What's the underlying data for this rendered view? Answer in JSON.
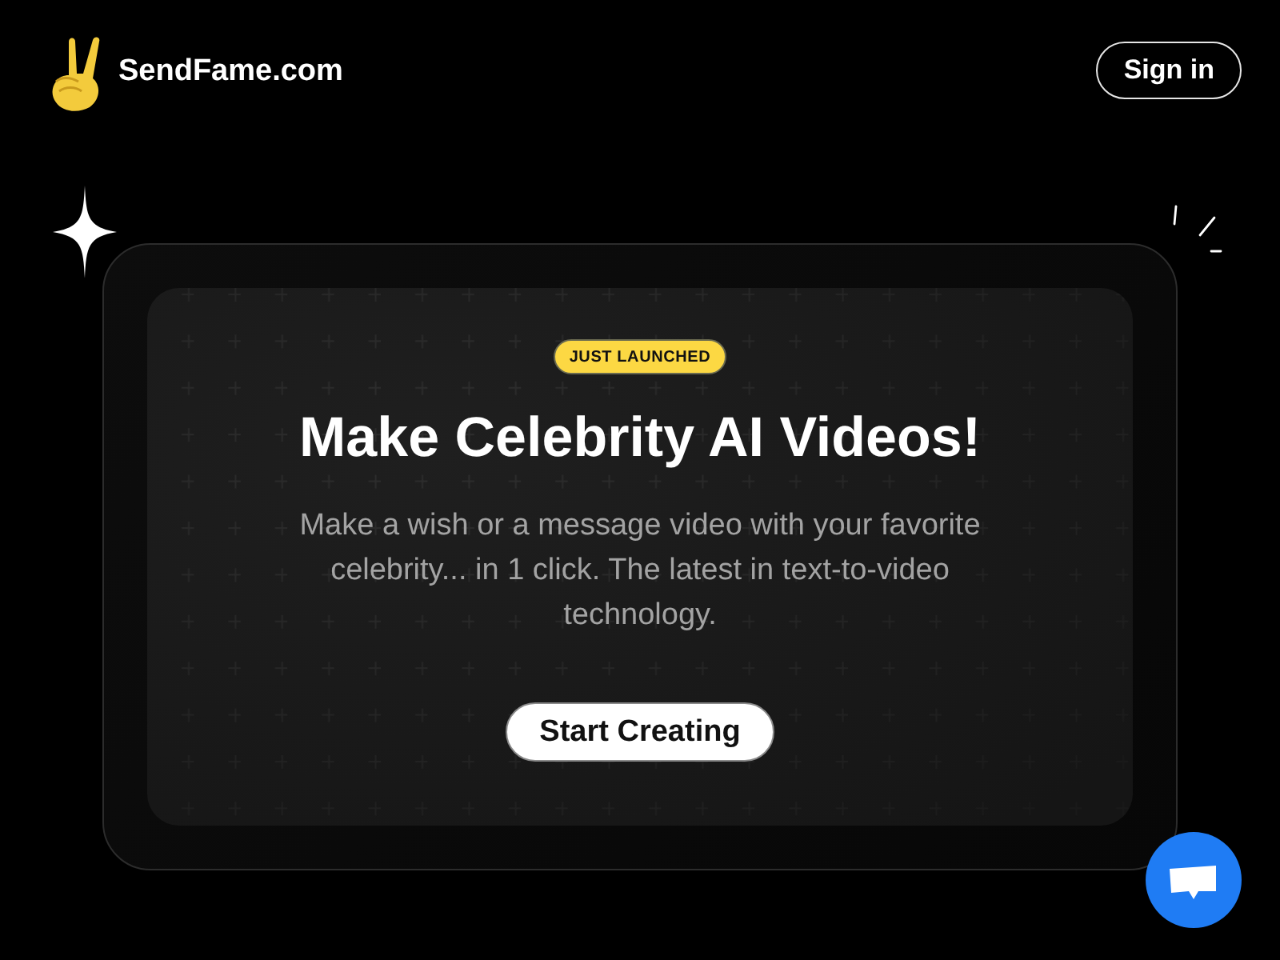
{
  "header": {
    "logo_text": "SendFame.com",
    "sign_in": "Sign in"
  },
  "hero": {
    "badge": "JUST LAUNCHED",
    "title": "Make Celebrity AI Videos!",
    "description": "Make a wish or a message video with your favorite celebrity... in 1 click. The latest in text-to-video technology.",
    "button": "Start Creating"
  }
}
